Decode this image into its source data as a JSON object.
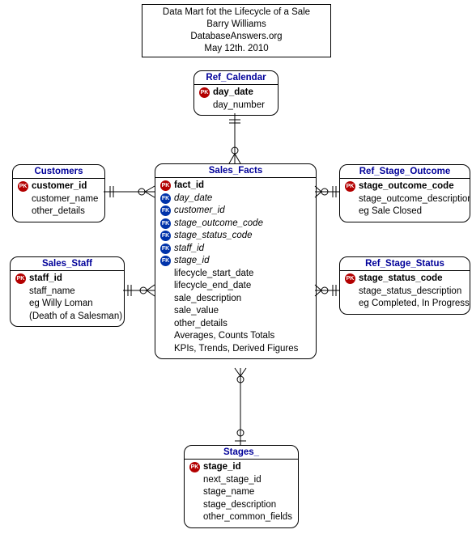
{
  "title_box": {
    "line1": "Data Mart fot the Lifecycle of a Sale",
    "line2": "Barry Williams",
    "line3": "DatabaseAnswers.org",
    "line4": "May 12th. 2010"
  },
  "entities": {
    "ref_calendar": {
      "title": "Ref_Calendar",
      "attrs": [
        {
          "icon": "pk",
          "text": "day_date",
          "style": "pk"
        },
        {
          "icon": "",
          "text": "day_number",
          "style": ""
        }
      ]
    },
    "customers": {
      "title": "Customers",
      "attrs": [
        {
          "icon": "pk",
          "text": "customer_id",
          "style": "pk"
        },
        {
          "icon": "",
          "text": "customer_name",
          "style": ""
        },
        {
          "icon": "",
          "text": "other_details",
          "style": ""
        }
      ]
    },
    "sales_staff": {
      "title": "Sales_Staff",
      "attrs": [
        {
          "icon": "pk",
          "text": "staff_id",
          "style": "pk"
        },
        {
          "icon": "",
          "text": "staff_name",
          "style": ""
        },
        {
          "icon": "",
          "text": "eg Willy Loman",
          "style": ""
        },
        {
          "icon": "",
          "text": "(Death of a Salesman)",
          "style": ""
        }
      ]
    },
    "sales_facts": {
      "title": "Sales_Facts",
      "attrs": [
        {
          "icon": "pk",
          "text": "fact_id",
          "style": "pk"
        },
        {
          "icon": "fk",
          "text": "day_date",
          "style": "fk"
        },
        {
          "icon": "fk",
          "text": "customer_id",
          "style": "fk"
        },
        {
          "icon": "fk",
          "text": "stage_outcome_code",
          "style": "fk"
        },
        {
          "icon": "fk",
          "text": "stage_status_code",
          "style": "fk"
        },
        {
          "icon": "fk",
          "text": "staff_id",
          "style": "fk"
        },
        {
          "icon": "fk",
          "text": "stage_id",
          "style": "fk"
        },
        {
          "icon": "",
          "text": "lifecycle_start_date",
          "style": ""
        },
        {
          "icon": "",
          "text": "lifecycle_end_date",
          "style": ""
        },
        {
          "icon": "",
          "text": "sale_description",
          "style": ""
        },
        {
          "icon": "",
          "text": "sale_value",
          "style": ""
        },
        {
          "icon": "",
          "text": "other_details",
          "style": ""
        },
        {
          "icon": "",
          "text": "Averages, Counts Totals",
          "style": ""
        },
        {
          "icon": "",
          "text": "KPIs, Trends, Derived Figures",
          "style": ""
        }
      ]
    },
    "ref_stage_outcome": {
      "title": "Ref_Stage_Outcome",
      "attrs": [
        {
          "icon": "pk",
          "text": "stage_outcome_code",
          "style": "pk"
        },
        {
          "icon": "",
          "text": "stage_outcome_description",
          "style": ""
        },
        {
          "icon": "",
          "text": "eg Sale Closed",
          "style": ""
        }
      ]
    },
    "ref_stage_status": {
      "title": "Ref_Stage_Status",
      "attrs": [
        {
          "icon": "pk",
          "text": "stage_status_code",
          "style": "pk"
        },
        {
          "icon": "",
          "text": "stage_status_description",
          "style": ""
        },
        {
          "icon": "",
          "text": "eg Completed, In Progress",
          "style": ""
        }
      ]
    },
    "stages": {
      "title": "Stages_",
      "attrs": [
        {
          "icon": "pk",
          "text": "stage_id",
          "style": "pk"
        },
        {
          "icon": "",
          "text": "next_stage_id",
          "style": ""
        },
        {
          "icon": "",
          "text": "stage_name",
          "style": ""
        },
        {
          "icon": "",
          "text": "stage_description",
          "style": ""
        },
        {
          "icon": "",
          "text": "other_common_fields",
          "style": ""
        }
      ]
    }
  }
}
